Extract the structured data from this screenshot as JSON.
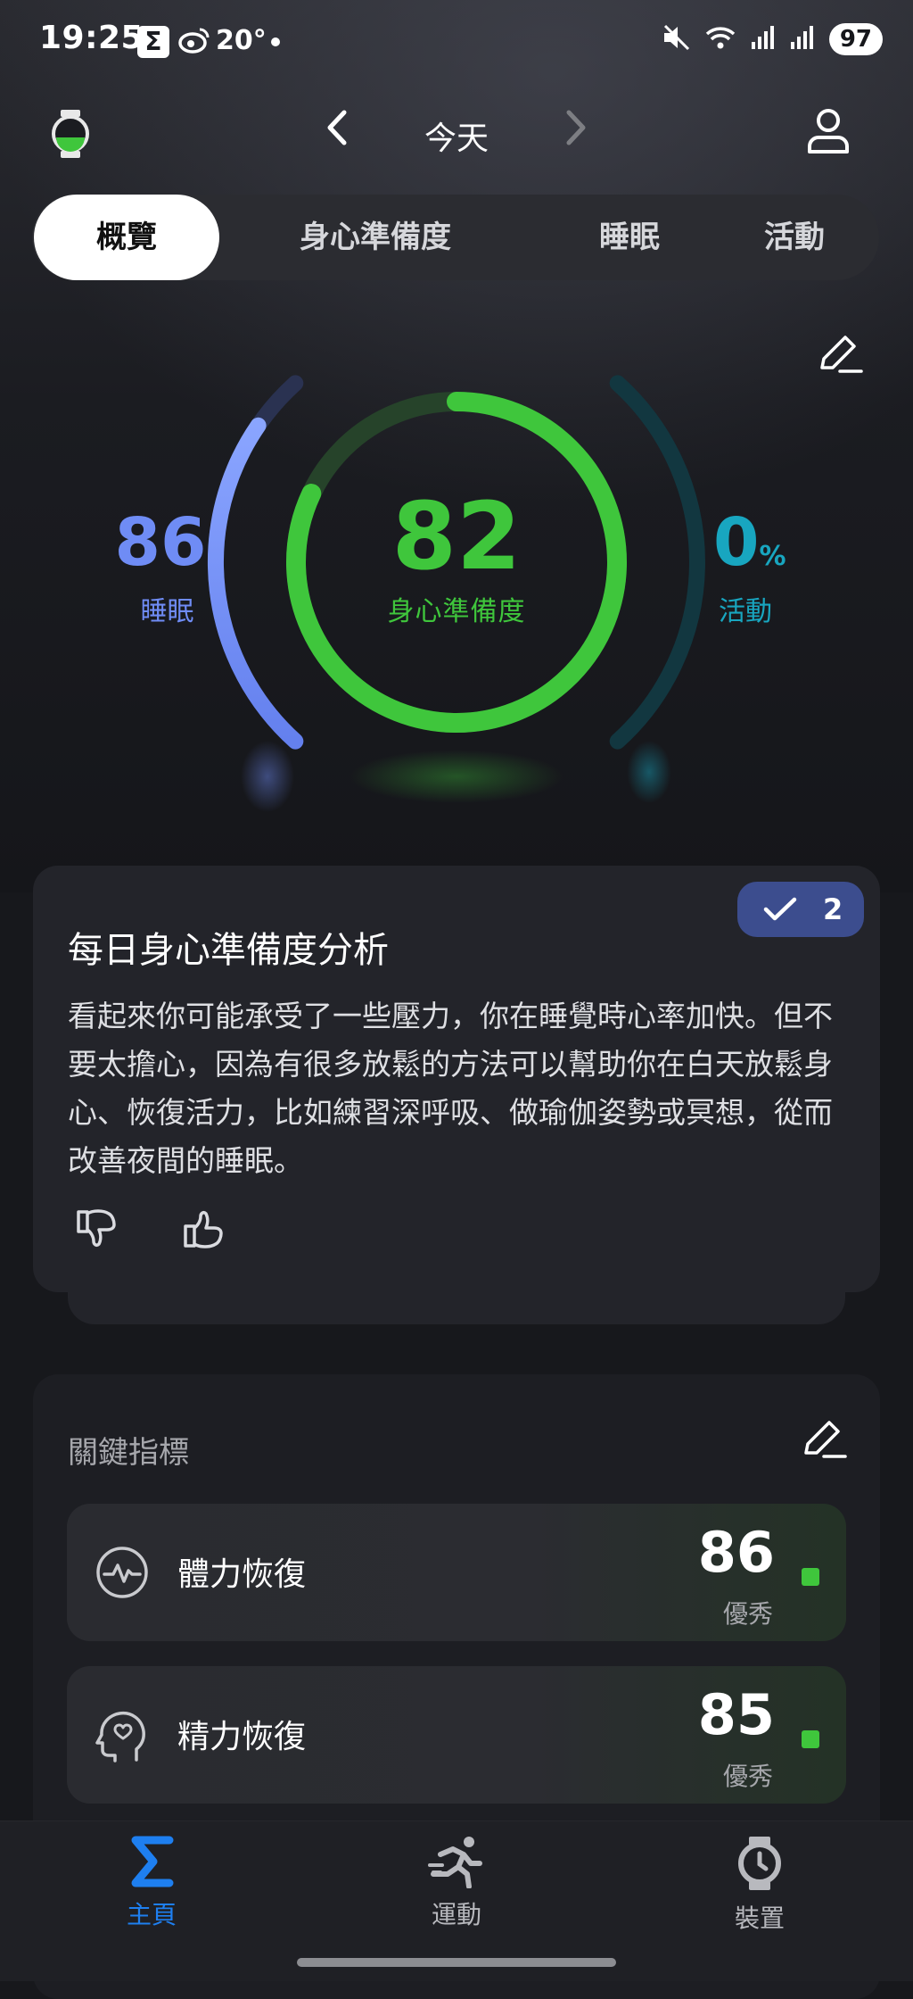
{
  "status_bar": {
    "time": "19:25",
    "notif_badge": "Σ",
    "weibo_icon": "weibo-icon",
    "temperature": "20°",
    "battery": "97"
  },
  "header": {
    "date": "今天"
  },
  "tabs": [
    {
      "label": "概覽",
      "active": true
    },
    {
      "label": "身心準備度",
      "active": false
    },
    {
      "label": "睡眠",
      "active": false
    },
    {
      "label": "活動",
      "active": false
    }
  ],
  "rings": {
    "readiness": {
      "value": "82",
      "label": "身心準備度",
      "color": "#3fc63c",
      "fraction": 0.82
    },
    "sleep": {
      "value": "86",
      "label": "睡眠",
      "color": "#6f8cf5",
      "fraction": 0.86
    },
    "activity": {
      "value": "0",
      "unit": "%",
      "label": "活動",
      "color": "#18a6c0",
      "fraction": 0.0
    }
  },
  "analysis": {
    "title": "每日身心準備度分析",
    "badge_count": "2",
    "body": "看起來你可能承受了一些壓力，你在睡覺時心率加快。但不要太擔心，因為有很多放鬆的方法可以幫助你在白天放鬆身心、恢復活力，比如練習深呼吸、做瑜伽姿勢或冥想，從而改善夜間的睡眠。"
  },
  "metrics": {
    "title": "關鍵指標",
    "items": [
      {
        "label": "體力恢復",
        "value": "86",
        "status": "優秀",
        "icon": "heartbeat-icon"
      },
      {
        "label": "精力恢復",
        "value": "85",
        "status": "優秀",
        "icon": "mind-icon"
      }
    ]
  },
  "bottom_nav": [
    {
      "label": "主頁",
      "icon": "sigma-icon",
      "active": true,
      "color": "#1e7ff0"
    },
    {
      "label": "運動",
      "icon": "running-icon",
      "active": false,
      "color": "#b8b9be"
    },
    {
      "label": "裝置",
      "icon": "watch-icon",
      "active": false,
      "color": "#b8b9be"
    }
  ]
}
